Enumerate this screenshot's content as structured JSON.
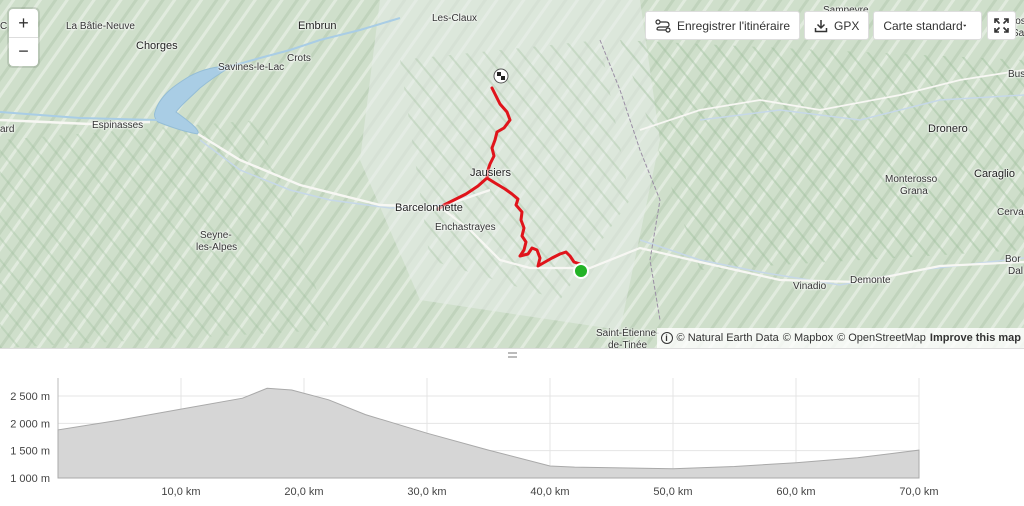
{
  "map": {
    "zoom_in": "+",
    "zoom_out": "−",
    "toolbar": {
      "save_route_label": "Enregistrer l'itinéraire",
      "gpx_label": "GPX",
      "map_style_label": "Carte standard"
    },
    "attribution": {
      "natural_earth": "© Natural Earth Data",
      "mapbox": "© Mapbox",
      "osm": "© OpenStreetMap",
      "improve": "Improve this map"
    },
    "places": {
      "la_batie_neuve": "La Bâtie-Neuve",
      "embrun": "Embrun",
      "les_claux": "Les-Claux",
      "chorges": "Chorges",
      "crots": "Crots",
      "savines": "Savines-le-Lac",
      "espinasses": "Espinasses",
      "jausiers": "Jausiers",
      "barcelonnette": "Barcelonnette",
      "enchastrayes": "Enchastrayes",
      "seyne_1": "Seyne-",
      "seyne_2": "les-Alpes",
      "dronero": "Dronero",
      "caraglio": "Caraglio",
      "monterosso_1": "Monterosso",
      "monterosso_2": "Grana",
      "vinadio": "Vinadio",
      "demonte": "Demonte",
      "st_etienne_1": "Saint-Étienne-",
      "st_etienne_2": "de-Tinée",
      "sampeyre": "Sampeyre",
      "partial_c": "C",
      "partial_ard": "ard",
      "partial_cos": "Cos",
      "partial_sa": "Sa",
      "partial_bus": "Bus",
      "partial_cerva": "Cerva",
      "partial_bor": "Bor",
      "partial_dal": "Dal"
    },
    "colors": {
      "route": "#e0141b",
      "start": "#22b326",
      "terrain": "#d5e4d2"
    }
  },
  "elevation": {
    "y_ticks": [
      "1 000 m",
      "1 500 m",
      "2 000 m",
      "2 500 m"
    ],
    "x_ticks": [
      "10,0 km",
      "20,0 km",
      "30,0 km",
      "40,0 km",
      "50,0 km",
      "60,0 km",
      "70,0 km"
    ],
    "profile_km": [
      0,
      5,
      10,
      15,
      17,
      19,
      22,
      25,
      30,
      35,
      40,
      42,
      50,
      55,
      60,
      65,
      70
    ],
    "profile_m": [
      1880,
      2060,
      2260,
      2460,
      2640,
      2610,
      2430,
      2160,
      1820,
      1510,
      1220,
      1200,
      1170,
      1210,
      1280,
      1370,
      1510
    ]
  }
}
